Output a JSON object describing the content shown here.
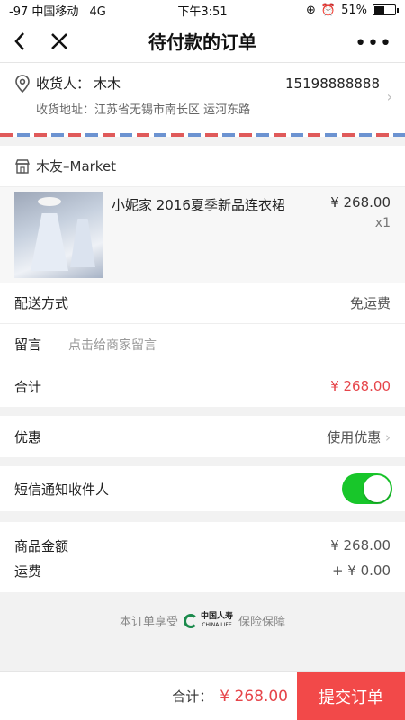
{
  "status": {
    "signal": "-97 中国移动",
    "network": "4G",
    "time": "下午3:51",
    "battery": "51%",
    "battery_level": 0.51
  },
  "nav": {
    "title": "待付款的订单",
    "more": "•••"
  },
  "address": {
    "recipient_label": "收货人：",
    "recipient_name": "木木",
    "phone": "15198888888",
    "address_label": "收货地址：",
    "address_value": "江苏省无锡市南长区 运河东路"
  },
  "shop": {
    "name": "木友–Market"
  },
  "product": {
    "title": "小妮家 2016夏季新品连衣裙",
    "price": "¥ 268.00",
    "quantity": "x1"
  },
  "delivery": {
    "label": "配送方式",
    "value": "免运费"
  },
  "message": {
    "label": "留言",
    "placeholder": "点击给商家留言"
  },
  "subtotal": {
    "label": "合计",
    "value": "¥ 268.00"
  },
  "discount": {
    "label": "优惠",
    "value": "使用优惠"
  },
  "sms": {
    "label": "短信通知收件人",
    "enabled": true
  },
  "summary": {
    "goods_label": "商品金额",
    "goods_value": "¥ 268.00",
    "shipping_label": "运费",
    "shipping_value": "+ ¥ 0.00"
  },
  "insurance": {
    "prefix": "本订单享受",
    "logo_cn": "中国人寿",
    "logo_en": "CHINA LIFE",
    "suffix": "保险保障"
  },
  "bottom": {
    "total_label": "合计：",
    "total_value": "¥ 268.00",
    "submit_label": "提交订单"
  },
  "colors": {
    "accent_red": "#f24949",
    "price_red": "#e6454a",
    "toggle_green": "#18c62a"
  }
}
